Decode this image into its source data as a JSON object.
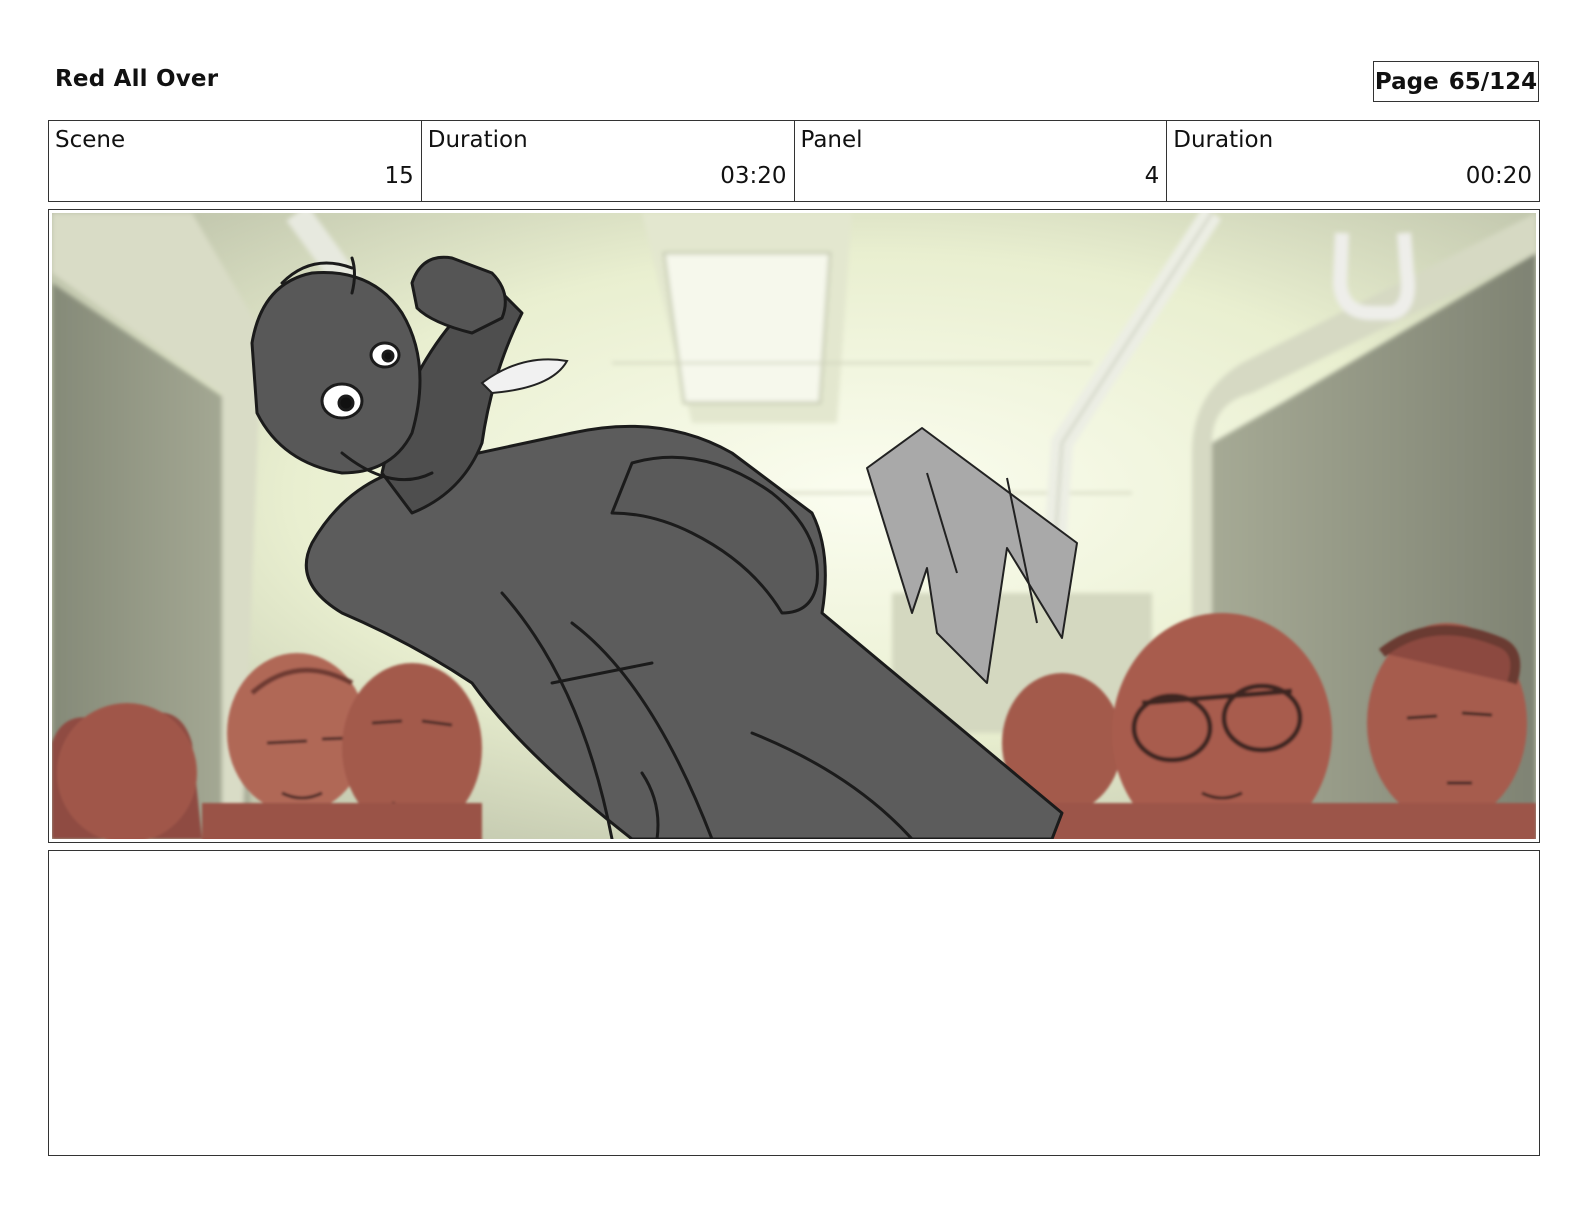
{
  "header": {
    "title": "Red All Over",
    "page_label": "Page",
    "page_value": "65/124"
  },
  "info": {
    "scene_label": "Scene",
    "scene_value": "15",
    "scene_duration_label": "Duration",
    "scene_duration_value": "03:20",
    "panel_label": "Panel",
    "panel_value": "4",
    "panel_duration_label": "Duration",
    "panel_duration_value": "00:20"
  },
  "notes": {
    "text": ""
  }
}
